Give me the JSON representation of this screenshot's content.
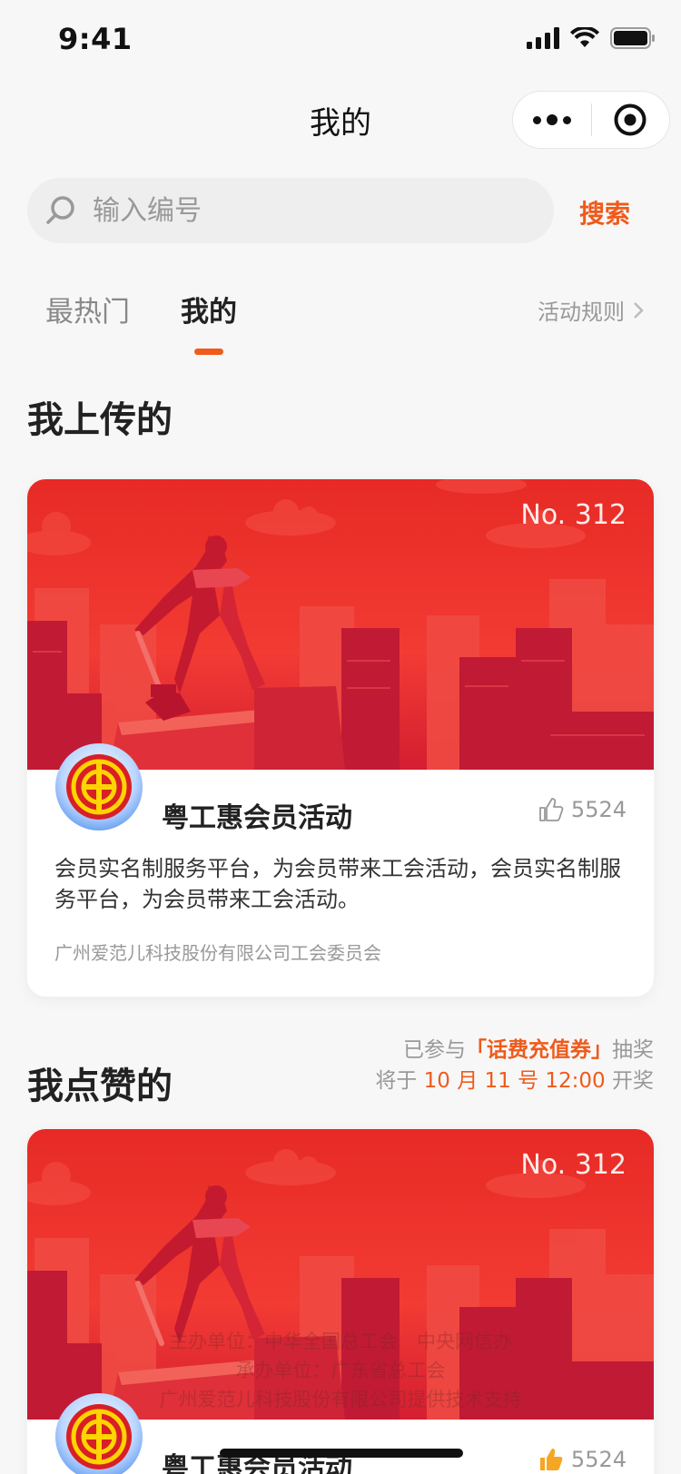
{
  "status": {
    "time": "9:41"
  },
  "nav": {
    "title": "我的"
  },
  "search": {
    "placeholder": "输入编号",
    "button_label": "搜索"
  },
  "tabs": [
    {
      "label": "最热门",
      "active": false
    },
    {
      "label": "我的",
      "active": true
    }
  ],
  "rules_link": "活动规则",
  "uploaded_section": {
    "title": "我上传的",
    "card": {
      "number": "No. 312",
      "title": "粤工惠会员活动",
      "likes": "5524",
      "description": "会员实名制服务平台，为会员带来工会活动，会员实名制服务平台，为会员带来工会活动。",
      "organization": "广州爱范儿科技股份有限公司工会委员会"
    }
  },
  "liked_section": {
    "title": "我点赞的",
    "lottery": {
      "line1_prefix": "已参与",
      "prize": "「话费充值券」",
      "line1_suffix": "抽奖",
      "line2_prefix": "将于",
      "draw_time": "10 月 11 号 12:00",
      "line2_suffix": "开奖"
    },
    "card": {
      "number": "No. 312",
      "title": "粤工惠会员活动",
      "likes": "5524"
    }
  },
  "footer": {
    "line1": "主办单位：中华全国总工会　中央网信办",
    "line2": "承办单位：广东省总工会",
    "line3": "广州爱范儿科技股份有限公司提供技术支持"
  },
  "colors": {
    "accent": "#ef5a1b",
    "banner": "#e72a25"
  }
}
